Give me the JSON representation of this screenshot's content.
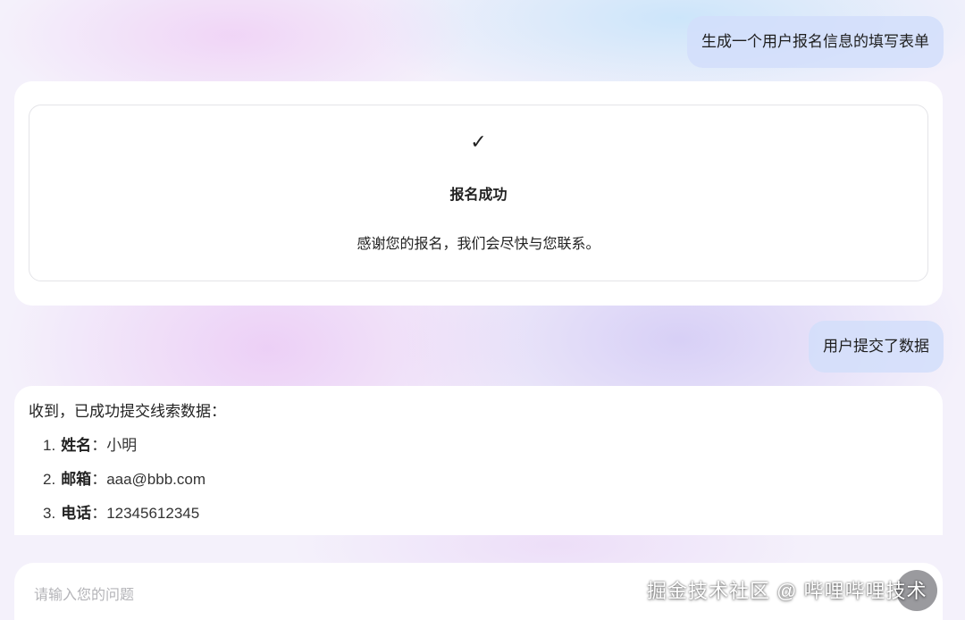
{
  "conversation": {
    "user_message_1": "生成一个用户报名信息的填写表单",
    "success_card": {
      "icon": "checkmark-icon",
      "check_glyph": "✓",
      "title": "报名成功",
      "text": "感谢您的报名，我们会尽快与您联系。"
    },
    "user_message_2": "用户提交了数据",
    "reply": {
      "intro": "收到，已成功提交线索数据：",
      "items": [
        {
          "num": "1.",
          "key": "姓名",
          "sep": "：",
          "value": "小明"
        },
        {
          "num": "2.",
          "key": "邮箱",
          "sep": "：",
          "value": "aaa@bbb.com"
        },
        {
          "num": "3.",
          "key": "电话",
          "sep": "：",
          "value": "12345612345"
        }
      ]
    }
  },
  "input": {
    "placeholder": "请输入您的问题"
  },
  "watermark": "掘金技术社区 @ 哔哩哔哩技术"
}
